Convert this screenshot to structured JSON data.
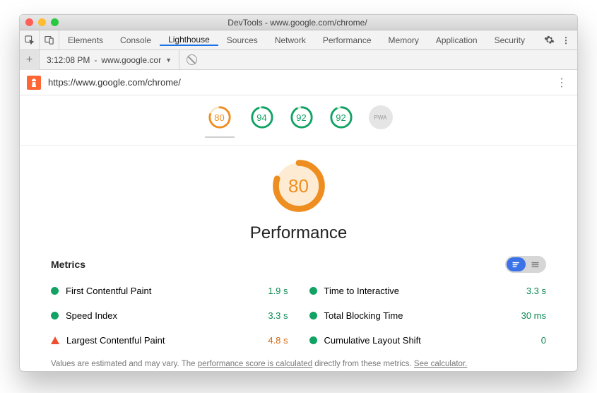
{
  "window": {
    "title": "DevTools - www.google.com/chrome/"
  },
  "tabs": {
    "items": [
      "Elements",
      "Console",
      "Lighthouse",
      "Sources",
      "Network",
      "Performance",
      "Memory",
      "Application",
      "Security"
    ],
    "activeIndex": 2
  },
  "subbar": {
    "timestamp": "3:12:08 PM",
    "host": "www.google.cor"
  },
  "url": "https://www.google.com/chrome/",
  "category_scores": [
    {
      "value": "80",
      "color": "#ef8e20",
      "pct": 80
    },
    {
      "value": "94",
      "color": "#11a264",
      "pct": 94
    },
    {
      "value": "92",
      "color": "#11a264",
      "pct": 92
    },
    {
      "value": "92",
      "color": "#11a264",
      "pct": 92
    }
  ],
  "pwa_label": "PWA",
  "gauge": {
    "value": "80",
    "pct": 80,
    "color": "#ef8e20"
  },
  "category_title": "Performance",
  "metrics_title": "Metrics",
  "metrics": {
    "left": [
      {
        "label": "First Contentful Paint",
        "value": "1.9 s",
        "status": "ok",
        "valColor": "green"
      },
      {
        "label": "Speed Index",
        "value": "3.3 s",
        "status": "ok",
        "valColor": "green"
      },
      {
        "label": "Largest Contentful Paint",
        "value": "4.8 s",
        "status": "warn",
        "valColor": "orange"
      }
    ],
    "right": [
      {
        "label": "Time to Interactive",
        "value": "3.3 s",
        "status": "ok",
        "valColor": "green"
      },
      {
        "label": "Total Blocking Time",
        "value": "30 ms",
        "status": "ok",
        "valColor": "green"
      },
      {
        "label": "Cumulative Layout Shift",
        "value": "0",
        "status": "ok",
        "valColor": "green"
      }
    ]
  },
  "footnote": {
    "t1": "Values are estimated and may vary. The ",
    "link1": "performance score is calculated",
    "t2": " directly from these metrics. ",
    "link2": "See calculator."
  }
}
